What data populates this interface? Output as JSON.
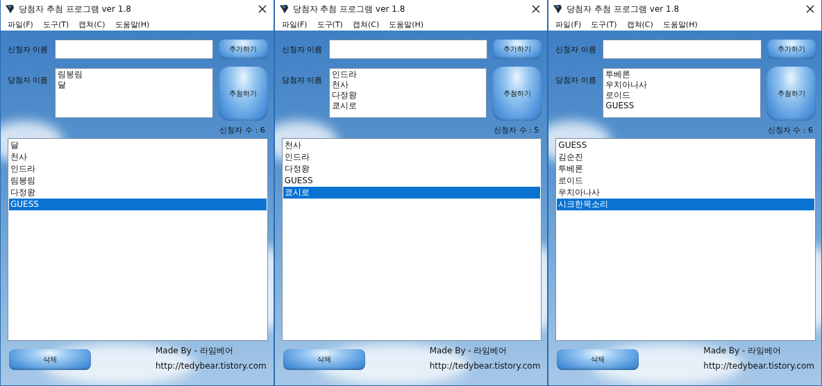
{
  "windows": [
    {
      "title": "당첨자 추첨 프로그램 ver 1.8",
      "menu": [
        "파일(F)",
        "도구(T)",
        "캡쳐(C)",
        "도움말(H)"
      ],
      "applicant_label": "신청자 이름",
      "add_button": "추가하기",
      "winner_label": "당첨자 이름",
      "winners": [
        "림봉림",
        "달"
      ],
      "draw_button": "추첨하기",
      "count": "신청자 수 : 6",
      "applicants": [
        {
          "name": "달",
          "selected": false
        },
        {
          "name": "천사",
          "selected": false
        },
        {
          "name": "인드라",
          "selected": false
        },
        {
          "name": "림봉림",
          "selected": false
        },
        {
          "name": "다정왕",
          "selected": false
        },
        {
          "name": "GUESS",
          "selected": true
        }
      ],
      "delete_button": "삭제",
      "credit": "Made By - 라임베어",
      "url": "http://tedybear.tistory.com"
    },
    {
      "title": "당첨자 추첨 프로그램 ver 1.8",
      "menu": [
        "파일(F)",
        "도구(T)",
        "캡쳐(C)",
        "도움말(H)"
      ],
      "applicant_label": "신청자 이름",
      "add_button": "추가하기",
      "winner_label": "당첨자 이름",
      "winners": [
        "인드라",
        "천사",
        "다정왕",
        "쿄시로"
      ],
      "draw_button": "추첨하기",
      "count": "신청자 수 : 5",
      "applicants": [
        {
          "name": "천사",
          "selected": false
        },
        {
          "name": "인드라",
          "selected": false
        },
        {
          "name": "다정왕",
          "selected": false
        },
        {
          "name": "GUESS",
          "selected": false
        },
        {
          "name": "쿄시로",
          "selected": true
        }
      ],
      "delete_button": "삭제",
      "credit": "Made By - 라임베어",
      "url": "http://tedybear.tistory.com"
    },
    {
      "title": "당첨자 추첨 프로그램 ver 1.8",
      "menu": [
        "파일(F)",
        "도구(T)",
        "캡쳐(C)",
        "도움말(H)"
      ],
      "applicant_label": "신청자 이름",
      "add_button": "추가하기",
      "winner_label": "당첨자 이름",
      "winners": [
        "투베론",
        "우치아나사",
        "로이드",
        "GUESS"
      ],
      "draw_button": "추첨하기",
      "count": "신청자 수 : 6",
      "applicants": [
        {
          "name": "GUESS",
          "selected": false
        },
        {
          "name": "김순진",
          "selected": false
        },
        {
          "name": "투베론",
          "selected": false
        },
        {
          "name": "로이드",
          "selected": false
        },
        {
          "name": "우치아나사",
          "selected": false
        },
        {
          "name": "시크한목소리",
          "selected": true
        }
      ],
      "delete_button": "삭제",
      "credit": "Made By - 라임베어",
      "url": "http://tedybear.tistory.com"
    }
  ]
}
